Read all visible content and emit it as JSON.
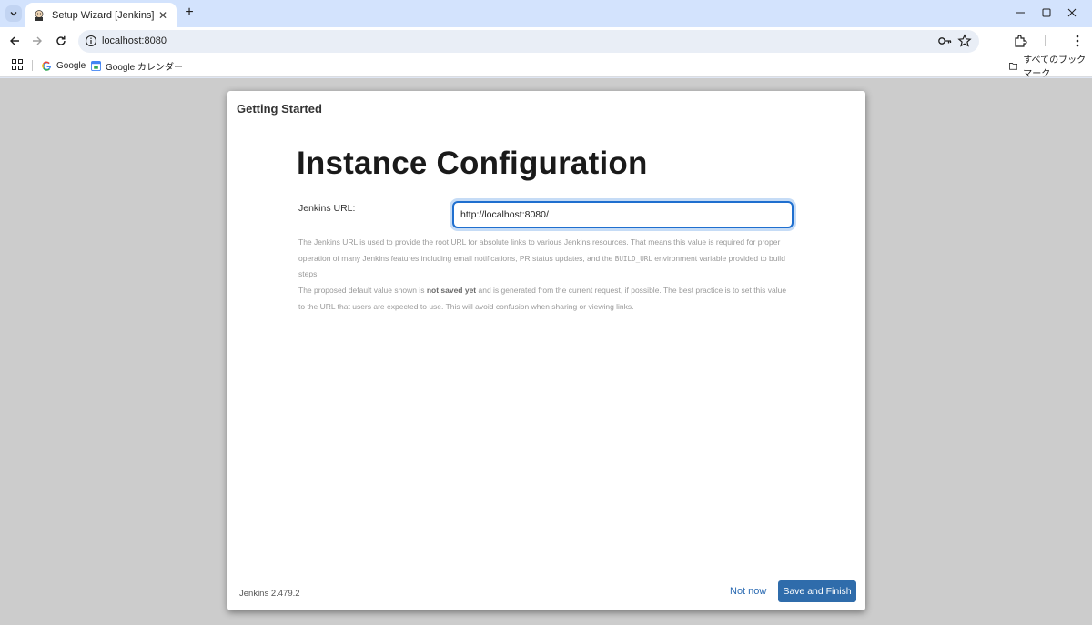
{
  "browser": {
    "tab_title": "Setup Wizard [Jenkins]",
    "address": "localhost:8080",
    "bookmarks": [
      {
        "label": "Google"
      },
      {
        "label": "Google カレンダー"
      }
    ],
    "all_bookmarks_label": "すべてのブックマーク"
  },
  "dialog": {
    "header_title": "Getting Started",
    "heading": "Instance Configuration",
    "url_label": "Jenkins URL:",
    "url_value": "http://localhost:8080/",
    "help_part1": "The Jenkins URL is used to provide the root URL for absolute links to various Jenkins resources. That means this value is required for proper operation of many Jenkins features including email notifications, PR status updates, and the ",
    "help_code": "BUILD_URL",
    "help_part2": " environment variable provided to build steps.",
    "help2_part1": "The proposed default value shown is ",
    "help2_bold": "not saved yet",
    "help2_part2": " and is generated from the current request, if possible. The best practice is to set this value to the URL that users are expected to use. This will avoid confusion when sharing or viewing links.",
    "version": "Jenkins 2.479.2",
    "not_now_label": "Not now",
    "save_label": "Save and Finish"
  },
  "colors": {
    "primary_button": "#2f6cab",
    "link": "#2a6ab2",
    "input_focus": "#1f6fcf"
  }
}
